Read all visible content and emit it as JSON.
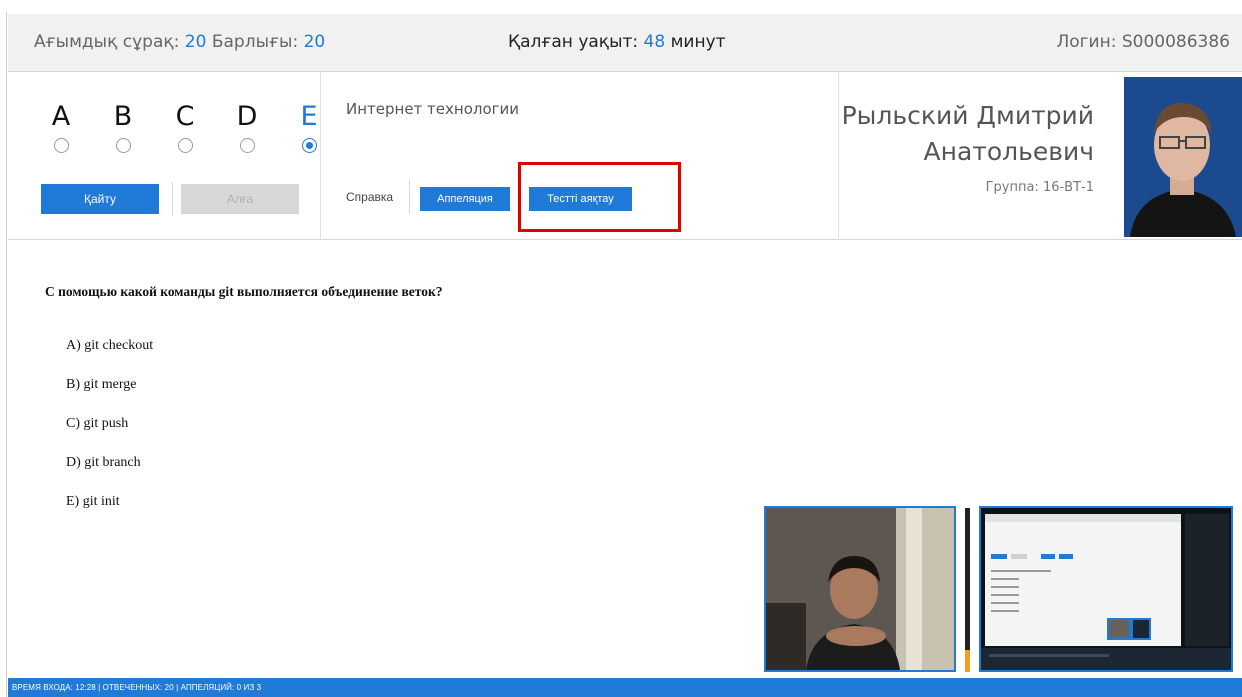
{
  "header": {
    "current_label": "Ағымдық сұрақ:",
    "current_value": "20",
    "total_label": "Барлығы:",
    "total_value": "20",
    "time_label": "Қалған уақыт:",
    "time_value": "48",
    "time_unit": "минут",
    "login_label": "Логин:",
    "login_value": "S000086386"
  },
  "options": [
    {
      "letter": "A",
      "checked": false
    },
    {
      "letter": "B",
      "checked": false
    },
    {
      "letter": "C",
      "checked": false
    },
    {
      "letter": "D",
      "checked": false
    },
    {
      "letter": "E",
      "checked": true
    }
  ],
  "nav": {
    "back_label": "Қайту",
    "next_label": "Алға"
  },
  "subject": "Интернет технологии",
  "actions": {
    "help_label": "Справка",
    "appeal_label": "Аппеляция",
    "finish_label": "Тестті аяқтау"
  },
  "student": {
    "name_line1": "Рыльский Дмитрий",
    "name_line2": "Анатольевич",
    "group": "Группа: 16-ВТ-1"
  },
  "question": {
    "text": "С помощью какой команды git выполняется объединение веток?",
    "answers": [
      "A) git checkout",
      "B) git merge",
      "C) git push",
      "D) git branch",
      "E) git init"
    ]
  },
  "footer": {
    "text": "ВРЕМЯ ВХОДА: 12:28  |  ОТВЕЧЕННЫХ: 20  |  АППЕЛЯЦИЙ: 0 ИЗ 3"
  },
  "colors": {
    "accent": "#1f7ad8",
    "highlight": "#e00000"
  }
}
